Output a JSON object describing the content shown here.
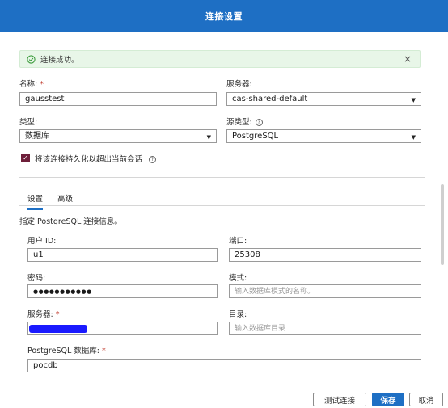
{
  "dialog": {
    "title": "连接设置"
  },
  "alert": {
    "message": "连接成功。",
    "close_glyph": "×"
  },
  "fields": {
    "name": {
      "label": "名称:",
      "value": "gausstest"
    },
    "server_select": {
      "label": "服务器:",
      "value": "cas-shared-default"
    },
    "type": {
      "label": "类型:",
      "value": "数据库"
    },
    "source_type": {
      "label": "源类型:",
      "value": "PostgreSQL"
    },
    "persist": {
      "label": "将该连接持久化以超出当前会话",
      "checked": true
    }
  },
  "tabs": [
    {
      "label": "设置",
      "active": true
    },
    {
      "label": "高级",
      "active": false
    }
  ],
  "section": {
    "description": "指定 PostgreSQL 连接信息。"
  },
  "conn": {
    "user_id": {
      "label": "用户 ID:",
      "value": "u1"
    },
    "port": {
      "label": "端口:",
      "value": "25308"
    },
    "password": {
      "label": "密码:",
      "value": "●●●●●●●●●●●"
    },
    "schema": {
      "label": "模式:",
      "placeholder": "输入数据库模式的名称。"
    },
    "server": {
      "label": "服务器:",
      "value": ""
    },
    "catalog": {
      "label": "目录:",
      "placeholder": "输入数据库目录"
    },
    "database": {
      "label": "PostgreSQL 数据库:",
      "value": "pocdb"
    }
  },
  "footer": {
    "test_label": "测试连接",
    "save_label": "保存",
    "cancel_label": "取消"
  },
  "glyphs": {
    "required": "*",
    "help": "?",
    "caret": "▼",
    "check": "✓"
  },
  "colors": {
    "header": "#1e6fc4",
    "checkbox": "#6e1f3a",
    "alert_bg": "#e8f6e8",
    "success_icon": "#3a9a3a",
    "required": "#c0392b"
  }
}
